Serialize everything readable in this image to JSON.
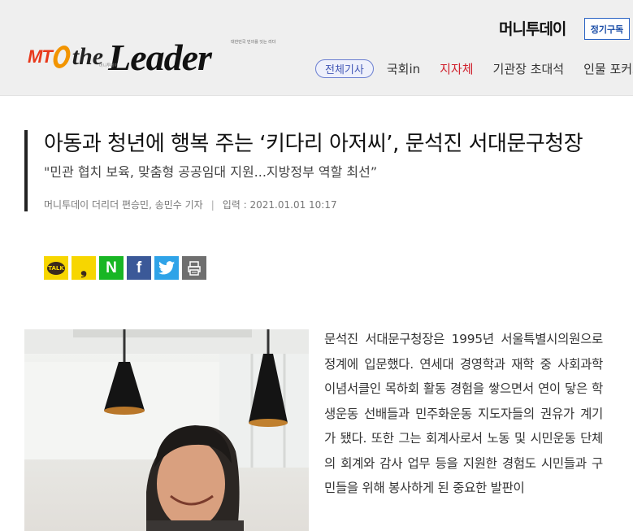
{
  "header": {
    "logo": {
      "mt": "MT",
      "the": "the",
      "leader": "Leader",
      "sub_small": "대한민국 민의를 잇는 리더",
      "sub_small2": "머니투데이"
    },
    "brand": "머니투데이",
    "subscribe_label": "정기구독",
    "nav": [
      {
        "label": "전체기사",
        "style": "pill"
      },
      {
        "label": "국회in",
        "style": "normal"
      },
      {
        "label": "지자체",
        "style": "active"
      },
      {
        "label": "기관장 초대석",
        "style": "normal"
      },
      {
        "label": "인물 포커스",
        "style": "normal"
      }
    ]
  },
  "article": {
    "title": "아동과 청년에 행복 주는 ‘키다리 아저씨’, 문석진 서대문구청장",
    "subtitle": "\"민관 협치 보육, 맞춤형 공공임대 지원...지방정부 역할 최선”",
    "author": "머니투데이 더리더 편승민, 송민수 기자",
    "separator": "|",
    "date": "입력 : 2021.01.01 10:17",
    "body": "문석진 서대문구청장은 1995년 서울특별시의원으로 정계에 입문했다. 연세대 경영학과 재학 중 사회과학 이념서클인 목하회 활동 경험을 쌓으면서 연이 닿은 학생운동 선배들과 민주화운동 지도자들의 권유가 계기가 됐다. 또한 그는 회계사로서 노동 및 시민운동 단체의 회계와 감사 업무 등을 지원한 경험도 시민들과 구민들을 위해 봉사하게 된 중요한 발판이"
  },
  "share": {
    "kakao_label": "TALK",
    "story_label": "❟",
    "naver_label": "N",
    "facebook_label": "f",
    "icons": [
      "kakaotalk-icon",
      "kakaostory-icon",
      "naver-icon",
      "facebook-icon",
      "twitter-icon",
      "print-icon"
    ]
  },
  "colors": {
    "accent_red": "#d0212d",
    "nav_pill": "#4156b5",
    "header_bg": "#efefef"
  }
}
